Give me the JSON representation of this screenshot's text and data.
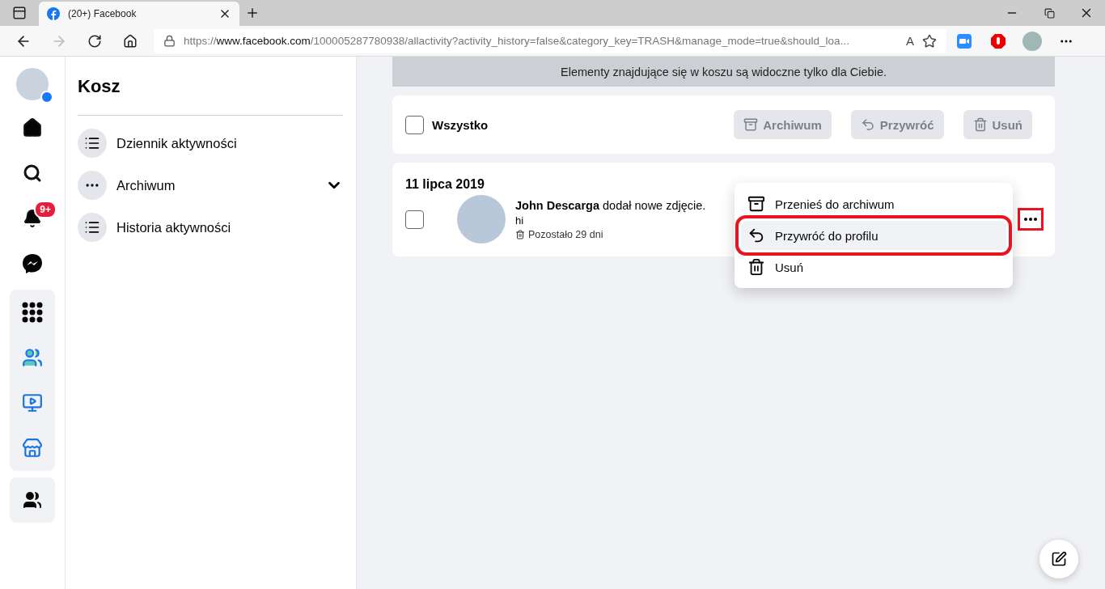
{
  "browser": {
    "tab_title": "(20+) Facebook",
    "url": {
      "scheme": "https://",
      "host": "www.facebook.com",
      "path": "/100005287780938/allactivity?activity_history=false&category_key=TRASH&manage_mode=true&should_loa..."
    }
  },
  "read_aloud_label": "A",
  "rail": {
    "notification_badge": "9+"
  },
  "sidebar": {
    "title": "Kosz",
    "items": [
      {
        "label": "Dziennik aktywności",
        "kind": "link"
      },
      {
        "label": "Archiwum",
        "kind": "dropdown"
      },
      {
        "label": "Historia aktywności",
        "kind": "link"
      }
    ]
  },
  "notice": "Elementy znajdujące się w koszu są widoczne tylko dla Ciebie.",
  "toolbar": {
    "select_all": {
      "label": "Wszystko",
      "checked": false
    },
    "buttons": [
      {
        "label": "Archiwum",
        "kind": "archive",
        "disabled": true
      },
      {
        "label": "Przywróć",
        "kind": "restore",
        "disabled": true
      },
      {
        "label": "Usuń",
        "kind": "delete",
        "disabled": true
      }
    ]
  },
  "group": {
    "date": "11 lipca 2019",
    "items": [
      {
        "text": "**John Descarga** dodał nowe zdjęcie.",
        "caption": "hi",
        "remaining": "Pozostało 29 dni",
        "checked": false,
        "more_annotated": true
      }
    ]
  },
  "menu": {
    "items": [
      {
        "label": "Przenieś do archiwum",
        "kind": "archive",
        "selected": false,
        "annotated": false
      },
      {
        "label": "Przywróć do profilu",
        "kind": "restore",
        "selected": true,
        "annotated": true
      },
      {
        "label": "Usuń",
        "kind": "delete",
        "selected": false,
        "annotated": false
      }
    ]
  }
}
